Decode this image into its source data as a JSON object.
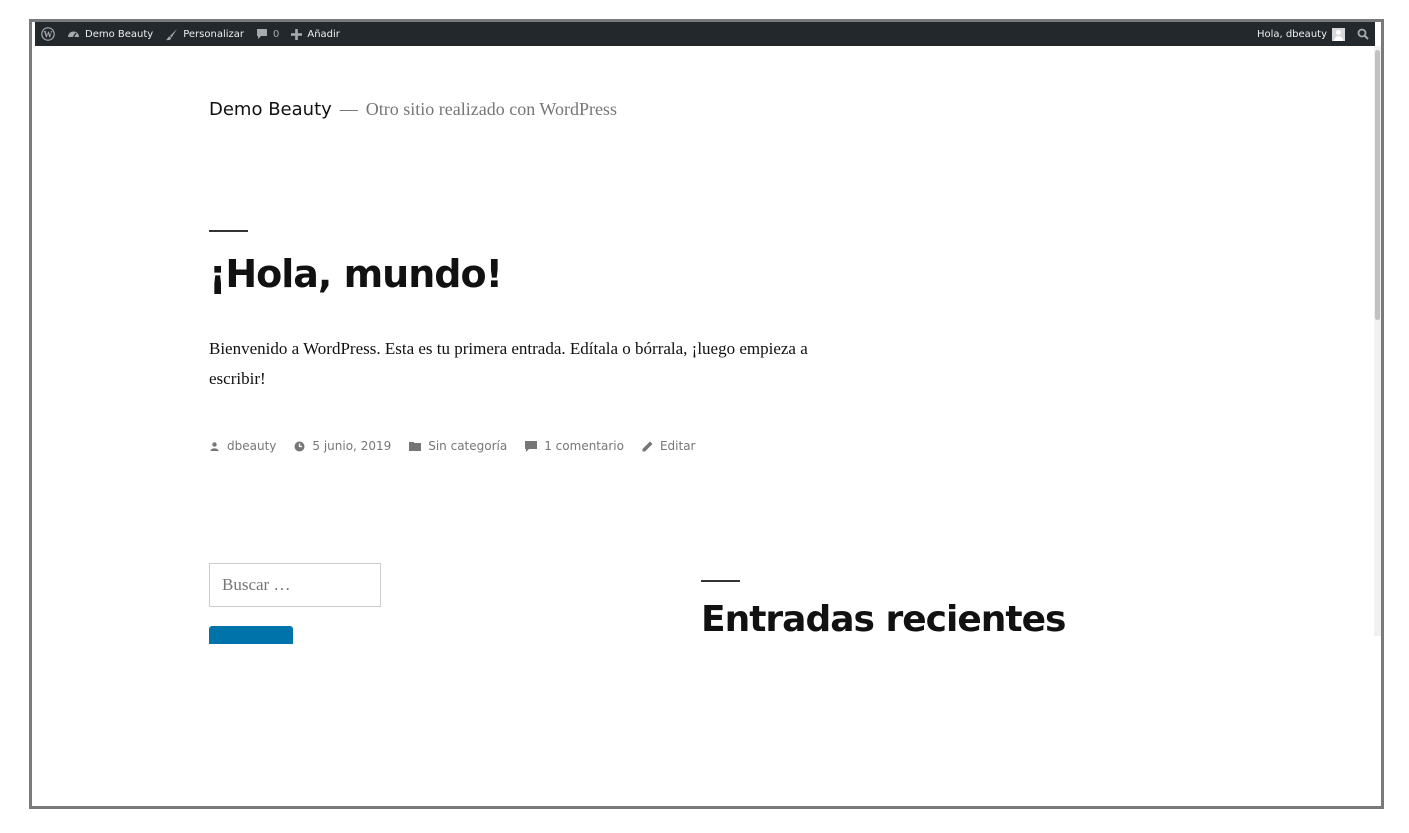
{
  "admin_bar": {
    "site_name": "Demo Beauty",
    "customize": "Personalizar",
    "comments_count": "0",
    "new": "Añadir",
    "greeting": "Hola, dbeauty"
  },
  "site": {
    "title": "Demo Beauty",
    "separator": "—",
    "description": "Otro sitio realizado con WordPress"
  },
  "post": {
    "title": "¡Hola, mundo!",
    "content": "Bienvenido a WordPress. Esta es tu primera entrada. Edítala o bórrala, ¡luego empieza a escribir!",
    "meta": {
      "author": "dbeauty",
      "date": "5 junio, 2019",
      "category": "Sin categoría",
      "comments": "1 comentario",
      "edit": "Editar"
    }
  },
  "sidebar": {
    "search_placeholder": "Buscar …",
    "recent_posts_title": "Entradas recientes"
  },
  "colors": {
    "admin_bar_bg": "#23282d",
    "button_blue": "#0073aa",
    "meta_gray": "#767676"
  }
}
